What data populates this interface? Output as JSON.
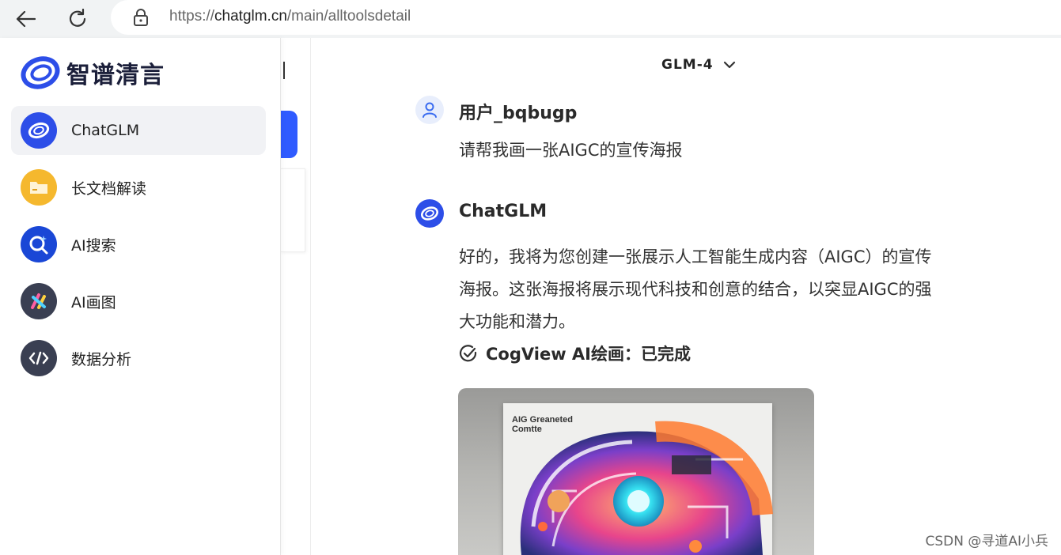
{
  "browser": {
    "url_prefix": "https://",
    "url_host": "chatglm.cn",
    "url_path": "/main/alltoolsdetail"
  },
  "sidebar": {
    "brand": "智谱清言",
    "items": [
      {
        "label": "ChatGLM",
        "icon": "chatglm-logo-icon",
        "color": "#2d4ee8"
      },
      {
        "label": "长文档解读",
        "icon": "folder-icon",
        "color": "#f5b82e"
      },
      {
        "label": "AI搜索",
        "icon": "search-icon",
        "color": "#1a47d6"
      },
      {
        "label": "AI画图",
        "icon": "paint-icon",
        "color": "#3a3f52"
      },
      {
        "label": "数据分析",
        "icon": "code-icon",
        "color": "#3a3f52"
      }
    ]
  },
  "header": {
    "model": "GLM-4"
  },
  "conversation": {
    "user_name": "用户_bqbugp",
    "user_message": "请帮我画一张AIGC的宣传海报",
    "bot_name": "ChatGLM",
    "bot_message_lines": [
      "好的，我将为您创建一张展示人工智能生成内容（AIGC）的宣传",
      "海报。这张海报将展示现代科技和创意的结合，以突显AIGC的强",
      "大功能和潜力。"
    ],
    "tool_status": "CogView AI绘画：已完成",
    "poster_title": "AIG Greaneted",
    "poster_subtitle": "Comtte"
  },
  "watermark": "CSDN @寻道AI小兵"
}
